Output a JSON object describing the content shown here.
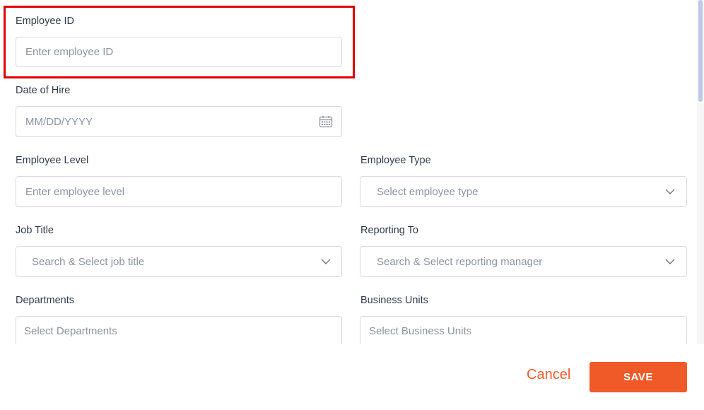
{
  "fields": {
    "employee_id": {
      "label": "Employee ID",
      "placeholder": "Enter employee ID"
    },
    "date_of_hire": {
      "label": "Date of Hire",
      "placeholder": "MM/DD/YYYY",
      "icon": "calendar-icon"
    },
    "employee_level": {
      "label": "Employee Level",
      "placeholder": "Enter employee level"
    },
    "employee_type": {
      "label": "Employee Type",
      "placeholder": "Select employee type",
      "icon": "chevron-down-icon"
    },
    "job_title": {
      "label": "Job Title",
      "placeholder": "Search & Select job title",
      "icon": "chevron-down-icon"
    },
    "reporting_to": {
      "label": "Reporting To",
      "placeholder": "Search & Select reporting manager",
      "icon": "chevron-down-icon"
    },
    "departments": {
      "label": "Departments",
      "placeholder": "Select Departments"
    },
    "business_units": {
      "label": "Business Units",
      "placeholder": "Select Business Units"
    }
  },
  "actions": {
    "cancel_label": "Cancel",
    "save_label": "SAVE"
  },
  "colors": {
    "accent": "#f05a28",
    "highlight": "#e00000",
    "border": "#d6dae0",
    "placeholder": "#8a93a0"
  }
}
